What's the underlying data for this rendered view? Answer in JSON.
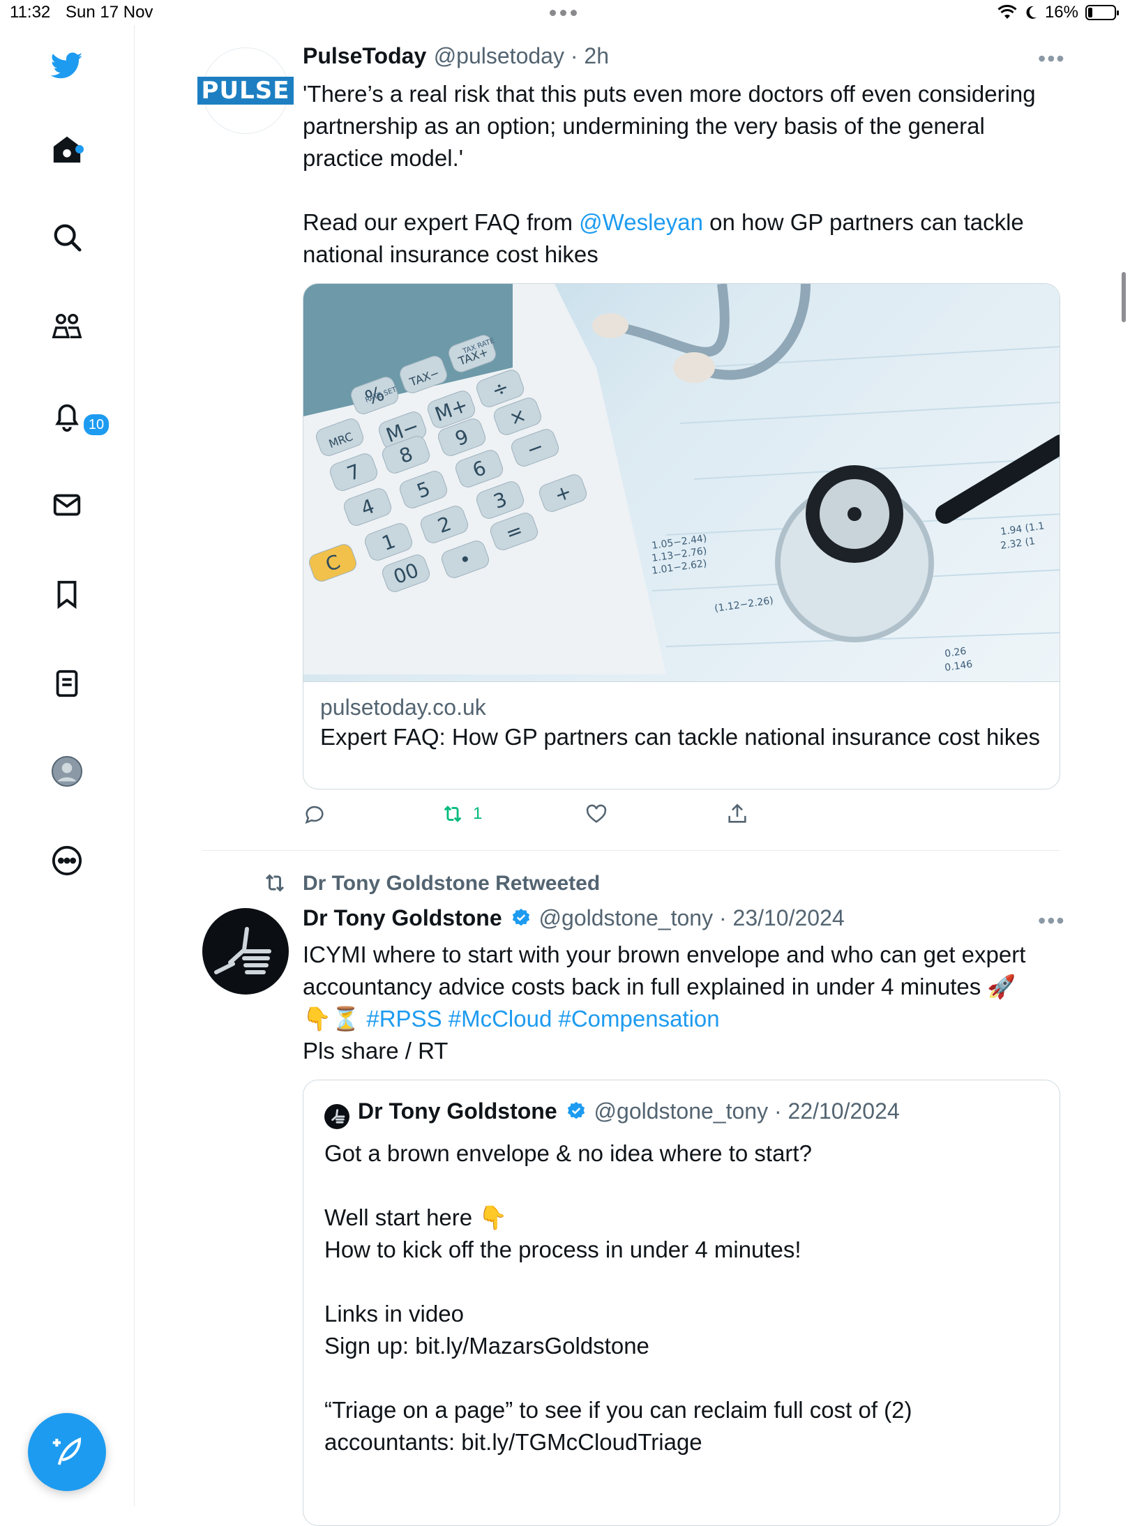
{
  "status_bar": {
    "time": "11:32",
    "date": "Sun 17 Nov",
    "battery": "16%",
    "battery_level": 0.16
  },
  "sidebar": {
    "items": [
      {
        "name": "twitter-logo-icon"
      },
      {
        "name": "home-icon"
      },
      {
        "name": "explore-icon"
      },
      {
        "name": "communities-icon"
      },
      {
        "name": "notifications-icon",
        "badge": "10"
      },
      {
        "name": "messages-icon"
      },
      {
        "name": "bookmarks-icon"
      },
      {
        "name": "lists-icon"
      },
      {
        "name": "profile-icon"
      },
      {
        "name": "more-icon"
      }
    ],
    "compose_icon": "compose-icon"
  },
  "tweet1": {
    "avatar_text": "PULSE",
    "display_name": "PulseToday",
    "meta": "@pulsetoday · 2h",
    "text_p1": "'There’s a real risk that this puts even more doctors off even considering partnership as an option; undermining the very basis of the general practice model.'",
    "text_p2_a": "Read our expert FAQ from ",
    "mention": "@Wesleyan",
    "text_p2_b": " on how GP partners can tackle national insurance cost hikes",
    "card": {
      "domain": "pulsetoday.co.uk",
      "title": "Expert FAQ: How GP partners can tackle national insurance cost hikes",
      "image_labels": {
        "keys": [
          "%",
          "TAX−",
          "TAX+",
          "M−",
          "M+",
          "÷",
          "MRC",
          "8",
          "9",
          "×",
          "7",
          "5",
          "6",
          "−",
          "4",
          "3",
          "+",
          "1",
          "2",
          "=",
          "C",
          "00",
          "•"
        ],
        "rate_set": "RATE SET",
        "tax_rate": "TAX RATE"
      }
    },
    "actions": {
      "retweet_count": "1"
    }
  },
  "tweet2": {
    "retweeted_by": "Dr Tony Goldstone Retweeted",
    "display_name": "Dr Tony Goldstone",
    "meta": "@goldstone_tony · 23/10/2024",
    "text_l1": "ICYMI where to start with your brown envelope and who can get expert accountancy advice costs back in full explained in under 4 minutes 🚀",
    "emoji": "👇⏳ ",
    "hashtags": "#RPSS #McCloud #Compensation",
    "text_l3": "Pls share / RT",
    "quote": {
      "display_name": "Dr Tony Goldstone",
      "meta": "@goldstone_tony · 22/10/2024",
      "lines": [
        "Got a brown envelope & no idea where to start?",
        "",
        "Well start here 👇",
        "How to kick off the process in under 4 minutes!",
        "",
        "Links in video",
        "Sign up: bit.ly/MazarsGoldstone",
        "",
        "“Triage on a page” to see if you can reclaim full cost of (2)",
        "accountants: bit.ly/TGMcCloudTriage"
      ]
    }
  },
  "colors": {
    "accent": "#1d9bf0",
    "retweet_green": "#00ba7c",
    "muted": "#536471"
  }
}
